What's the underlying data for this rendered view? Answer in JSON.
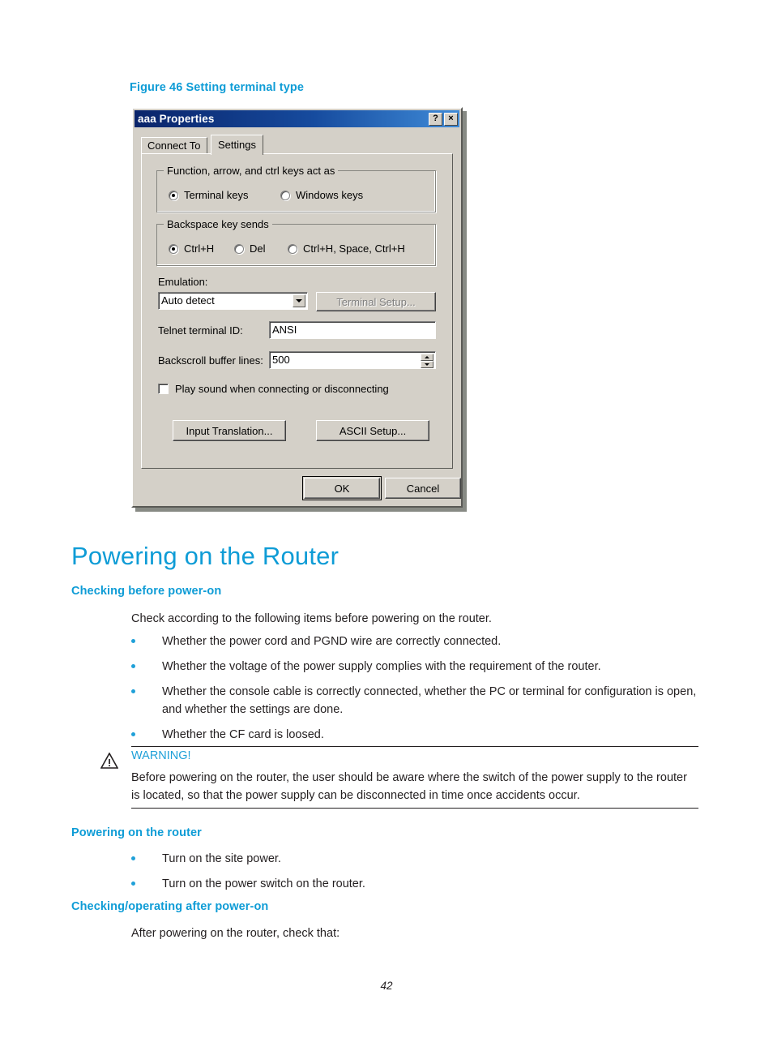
{
  "figure": {
    "caption": "Figure 46 Setting terminal type"
  },
  "dialog": {
    "title": "aaa Properties",
    "titlebar_buttons": [
      {
        "name": "help-button",
        "glyph": "?"
      },
      {
        "name": "close-button",
        "glyph": "×"
      }
    ],
    "tabs": [
      {
        "label": "Connect To",
        "active": false
      },
      {
        "label": "Settings",
        "active": true
      }
    ],
    "group_function_keys": {
      "legend": "Function, arrow, and ctrl keys act as",
      "options": [
        {
          "label": "Terminal keys",
          "selected": true
        },
        {
          "label": "Windows keys",
          "selected": false
        }
      ]
    },
    "group_backspace": {
      "legend": "Backspace key sends",
      "options": [
        {
          "label": "Ctrl+H",
          "selected": true
        },
        {
          "label": "Del",
          "selected": false
        },
        {
          "label": "Ctrl+H, Space, Ctrl+H",
          "selected": false
        }
      ]
    },
    "emulation": {
      "label": "Emulation:",
      "value": "Auto detect",
      "setup_button": "Terminal Setup...",
      "setup_button_disabled": true
    },
    "telnet_terminal_id": {
      "label": "Telnet terminal ID:",
      "value": "ANSI"
    },
    "backscroll_buffer_lines": {
      "label": "Backscroll buffer lines:",
      "value": "500"
    },
    "play_sound": {
      "label": "Play sound when connecting or disconnecting",
      "checked": false
    },
    "panel_buttons": [
      {
        "label": "Input Translation..."
      },
      {
        "label": "ASCII Setup..."
      }
    ],
    "footer_buttons": [
      {
        "label": "OK",
        "default": true
      },
      {
        "label": "Cancel",
        "default": false
      }
    ]
  },
  "content": {
    "h1": "Powering on the Router",
    "section_checking_before": {
      "heading": "Checking before power-on",
      "intro": "Check according to the following items before powering on the router.",
      "bullets": [
        "Whether the power cord and PGND wire are correctly connected.",
        "Whether the voltage of the power supply complies with the requirement of the router.",
        "Whether the console cable is correctly connected, whether the PC or terminal for configuration is open, and whether the settings are done.",
        "Whether the CF card is loosed."
      ]
    },
    "warning": {
      "title": "WARNING!",
      "text": "Before powering on the router, the user should be aware where the switch of the power supply to the router is located, so that the power supply can be disconnected in time once accidents occur."
    },
    "section_powering_on": {
      "heading": "Powering on the router",
      "bullets": [
        "Turn on the site power.",
        "Turn on the power switch on the router."
      ]
    },
    "section_checking_after": {
      "heading": "Checking/operating after power-on",
      "intro": "After powering on the router, check that:"
    }
  },
  "page_number": "42",
  "colors": {
    "accent_blue": "#0e9cd6",
    "bullet_blue": "#1fa0d8",
    "body_text": "#231f20",
    "dialog_face": "#d4d0c8",
    "titlebar_start": "#0a246a",
    "titlebar_end": "#3f8bd8"
  }
}
